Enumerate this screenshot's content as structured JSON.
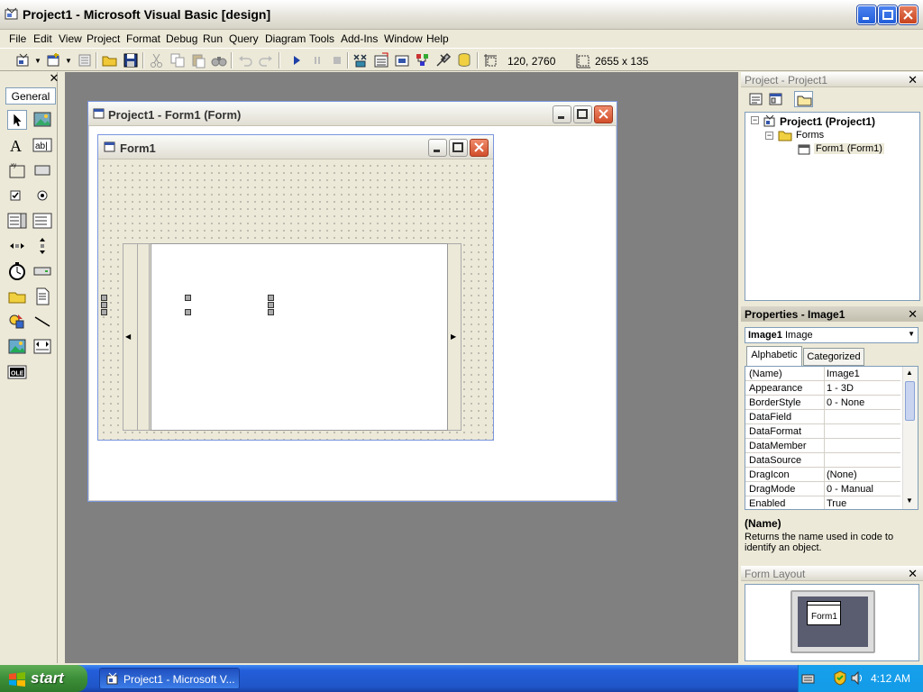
{
  "window": {
    "title": "Project1 - Microsoft Visual Basic [design]"
  },
  "menu": [
    "File",
    "Edit",
    "View",
    "Project",
    "Format",
    "Debug",
    "Run",
    "Query",
    "Diagram",
    "Tools",
    "Add-Ins",
    "Window",
    "Help"
  ],
  "toolbar": {
    "position": "120, 2760",
    "size": "2655 x 135"
  },
  "toolbox": {
    "tab": "General"
  },
  "form_window": {
    "title": "Project1 - Form1 (Form)"
  },
  "form1": {
    "title": "Form1"
  },
  "project_panel": {
    "title": "Project - Project1",
    "tree": {
      "root": "Project1 (Project1)",
      "folder": "Forms",
      "item": "Form1 (Form1)"
    }
  },
  "properties_panel": {
    "title": "Properties - Image1",
    "object_name": "Image1",
    "object_type": "Image",
    "tabs": [
      "Alphabetic",
      "Categorized"
    ],
    "rows": [
      {
        "name": "(Name)",
        "value": "Image1"
      },
      {
        "name": "Appearance",
        "value": "1 - 3D"
      },
      {
        "name": "BorderStyle",
        "value": "0 - None"
      },
      {
        "name": "DataField",
        "value": ""
      },
      {
        "name": "DataFormat",
        "value": ""
      },
      {
        "name": "DataMember",
        "value": ""
      },
      {
        "name": "DataSource",
        "value": ""
      },
      {
        "name": "DragIcon",
        "value": "(None)"
      },
      {
        "name": "DragMode",
        "value": "0 - Manual"
      },
      {
        "name": "Enabled",
        "value": "True"
      }
    ],
    "description_title": "(Name)",
    "description_text": "Returns the name used in code to identify an object."
  },
  "layout_panel": {
    "title": "Form Layout",
    "form_label": "Form1"
  },
  "taskbar": {
    "start": "start",
    "task": "Project1 - Microsoft V...",
    "clock": "4:12 AM"
  }
}
